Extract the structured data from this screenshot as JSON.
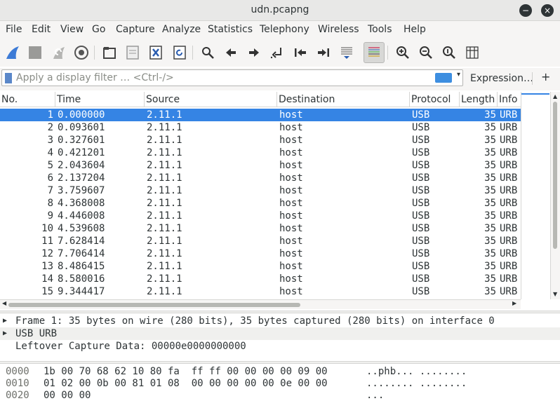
{
  "window": {
    "title": "udn.pcapng",
    "minimize_glyph": "−",
    "close_glyph": "×"
  },
  "menu": [
    "File",
    "Edit",
    "View",
    "Go",
    "Capture",
    "Analyze",
    "Statistics",
    "Telephony",
    "Wireless",
    "Tools",
    "Help"
  ],
  "toolbar": {
    "icons": [
      "shark-fin-start-icon",
      "stop-capture-icon",
      "restart-capture-icon",
      "capture-options-icon",
      "open-file-icon",
      "save-file-icon",
      "close-file-icon",
      "reload-file-icon",
      "find-packet-icon",
      "go-back-icon",
      "go-forward-icon",
      "go-to-packet-icon",
      "first-packet-icon",
      "last-packet-icon",
      "autoscroll-icon",
      "colorize-icon",
      "zoom-in-icon",
      "zoom-out-icon",
      "normal-size-icon",
      "resize-columns-icon"
    ],
    "active": "colorize-icon"
  },
  "filter": {
    "placeholder": "Apply a display filter … <Ctrl-/>",
    "value": "",
    "expression_label": "Expression…",
    "plus_label": "+"
  },
  "packet_list": {
    "columns": [
      "No.",
      "Time",
      "Source",
      "Destination",
      "Protocol",
      "Length",
      "Info"
    ],
    "selected_index": 0,
    "rows": [
      {
        "no": "1",
        "time": "0.000000",
        "source": "2.11.1",
        "destination": "host",
        "protocol": "USB",
        "length": "35",
        "info": "URB"
      },
      {
        "no": "2",
        "time": "0.093601",
        "source": "2.11.1",
        "destination": "host",
        "protocol": "USB",
        "length": "35",
        "info": "URB"
      },
      {
        "no": "3",
        "time": "0.327601",
        "source": "2.11.1",
        "destination": "host",
        "protocol": "USB",
        "length": "35",
        "info": "URB"
      },
      {
        "no": "4",
        "time": "0.421201",
        "source": "2.11.1",
        "destination": "host",
        "protocol": "USB",
        "length": "35",
        "info": "URB"
      },
      {
        "no": "5",
        "time": "2.043604",
        "source": "2.11.1",
        "destination": "host",
        "protocol": "USB",
        "length": "35",
        "info": "URB"
      },
      {
        "no": "6",
        "time": "2.137204",
        "source": "2.11.1",
        "destination": "host",
        "protocol": "USB",
        "length": "35",
        "info": "URB"
      },
      {
        "no": "7",
        "time": "3.759607",
        "source": "2.11.1",
        "destination": "host",
        "protocol": "USB",
        "length": "35",
        "info": "URB"
      },
      {
        "no": "8",
        "time": "4.368008",
        "source": "2.11.1",
        "destination": "host",
        "protocol": "USB",
        "length": "35",
        "info": "URB"
      },
      {
        "no": "9",
        "time": "4.446008",
        "source": "2.11.1",
        "destination": "host",
        "protocol": "USB",
        "length": "35",
        "info": "URB"
      },
      {
        "no": "10",
        "time": "4.539608",
        "source": "2.11.1",
        "destination": "host",
        "protocol": "USB",
        "length": "35",
        "info": "URB"
      },
      {
        "no": "11",
        "time": "7.628414",
        "source": "2.11.1",
        "destination": "host",
        "protocol": "USB",
        "length": "35",
        "info": "URB"
      },
      {
        "no": "12",
        "time": "7.706414",
        "source": "2.11.1",
        "destination": "host",
        "protocol": "USB",
        "length": "35",
        "info": "URB"
      },
      {
        "no": "13",
        "time": "8.486415",
        "source": "2.11.1",
        "destination": "host",
        "protocol": "USB",
        "length": "35",
        "info": "URB"
      },
      {
        "no": "14",
        "time": "8.580016",
        "source": "2.11.1",
        "destination": "host",
        "protocol": "USB",
        "length": "35",
        "info": "URB"
      },
      {
        "no": "15",
        "time": "9.344417",
        "source": "2.11.1",
        "destination": "host",
        "protocol": "USB",
        "length": "35",
        "info": "URB"
      }
    ]
  },
  "details": [
    {
      "expandable": true,
      "text": "Frame 1: 35 bytes on wire (280 bits), 35 bytes captured (280 bits) on interface 0"
    },
    {
      "expandable": true,
      "text": "USB URB"
    },
    {
      "expandable": false,
      "text": "Leftover Capture Data: 00000e0000000000"
    }
  ],
  "bytes": [
    {
      "offset": "0000",
      "hex": "1b 00 70 68 62 10 80 fa  ff ff 00 00 00 00 09 00",
      "ascii": "..phb... ........"
    },
    {
      "offset": "0010",
      "hex": "01 02 00 0b 00 81 01 08  00 00 00 00 00 0e 00 00",
      "ascii": "........ ........"
    },
    {
      "offset": "0020",
      "hex": "00 00 00",
      "ascii": "..."
    }
  ],
  "colors": {
    "selection": "#3584e4",
    "chrome": "#f6f5f4",
    "titlebar": "#e8e8e7",
    "text": "#2e3436"
  }
}
